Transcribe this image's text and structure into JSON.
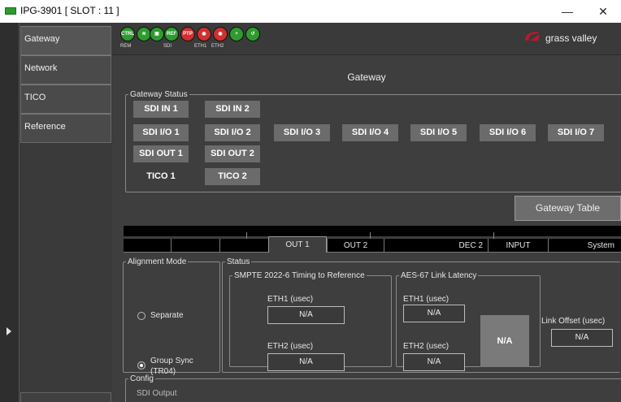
{
  "window": {
    "title": "IPG-3901 [ SLOT : 11 ]",
    "minimize": "—",
    "maximize": "☐",
    "close": "✕"
  },
  "sidebar": {
    "items": [
      {
        "label": "Gateway"
      },
      {
        "label": "Network"
      },
      {
        "label": "TICO"
      },
      {
        "label": "Reference"
      }
    ]
  },
  "toolbar": {
    "leds": [
      {
        "label": "CTRL",
        "sub": "REM",
        "color": "#2e9b2e",
        "icon": "ctrl-led-icon"
      },
      {
        "label": "≋",
        "sub": "",
        "color": "#2e9b2e",
        "icon": "signal-led-icon"
      },
      {
        "label": "▣",
        "sub": "SDI",
        "color": "#2e9b2e",
        "icon": "sdi-led-icon"
      },
      {
        "label": "REF",
        "sub": "",
        "color": "#2e9b2e",
        "icon": "ref-led-icon"
      },
      {
        "label": "PTP",
        "sub": "",
        "color": "#d03030",
        "icon": "ptp-led-icon"
      },
      {
        "label": "◉",
        "sub": "ETH1",
        "color": "#d03030",
        "icon": "eth1-led-icon"
      },
      {
        "label": "◉",
        "sub": "ETH2",
        "color": "#d03030",
        "icon": "eth2-led-icon"
      },
      {
        "label": "+",
        "sub": "",
        "color": "#2e9b2e",
        "icon": "add-led-icon"
      },
      {
        "label": "↺",
        "sub": "",
        "color": "#2e9b2e",
        "icon": "refresh-led-icon"
      }
    ],
    "brand": "grass valley"
  },
  "gateway": {
    "title": "Gateway",
    "status_legend": "Gateway Status",
    "ports": {
      "sdi_in": [
        "SDI IN 1",
        "SDI IN 2"
      ],
      "sdi_io": [
        "SDI I/O 1",
        "SDI I/O 2",
        "SDI I/O 3",
        "SDI I/O 4",
        "SDI I/O 5",
        "SDI I/O 6",
        "SDI I/O 7"
      ],
      "sdi_out": [
        "SDI OUT 1",
        "SDI OUT 2"
      ],
      "tico": [
        "TICO 1",
        "TICO 2"
      ]
    },
    "table_button": "Gateway Table"
  },
  "tabs": [
    "OUT 1",
    "OUT 2",
    "DEC 2",
    "INPUT",
    "System"
  ],
  "panel": {
    "alignment": {
      "legend": "Alignment Mode",
      "options": [
        "Separate",
        "Group Sync\n(TR04)"
      ],
      "selected": "Group Sync (TR04)"
    },
    "status_legend": "Status",
    "smpte": {
      "legend": "SMPTE 2022-6 Timing to Reference",
      "eth1_label": "ETH1 (usec)",
      "eth1_value": "N/A",
      "eth2_label": "ETH2 (usec)",
      "eth2_value": "N/A"
    },
    "aes": {
      "legend": "AES-67 Link Latency",
      "eth1_label": "ETH1 (usec)",
      "eth1_value": "N/A",
      "eth2_label": "ETH2 (usec)",
      "eth2_value": "N/A",
      "combined_value": "N/A"
    },
    "link_offset_label": "Link Offset (usec)",
    "link_offset_value": "N/A"
  },
  "config": {
    "legend": "Config",
    "sdi_output": "SDI Output"
  }
}
